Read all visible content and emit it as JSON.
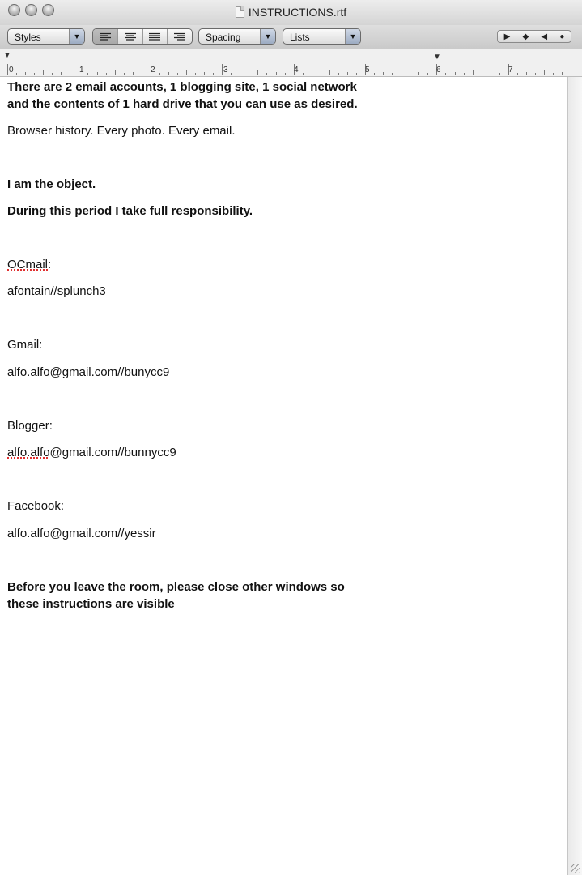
{
  "window": {
    "title": "INSTRUCTIONS.rtf"
  },
  "toolbar": {
    "styles_label": "Styles",
    "spacing_label": "Spacing",
    "lists_label": "Lists"
  },
  "ruler": {
    "numbers": [
      "0",
      "1",
      "2",
      "3",
      "4",
      "5",
      "6",
      "7"
    ]
  },
  "document": {
    "intro_line1": "There are 2 email accounts, 1 blogging site, 1 social network",
    "intro_line2": "and the contents of 1 hard drive that you can use as desired.",
    "browser_line": "Browser history. Every photo. Every email.",
    "object_line": "I am the object.",
    "responsibility_line": "During this period I take full responsibility.",
    "ocmail_label_a": "OCmail",
    "ocmail_label_b": ":",
    "ocmail_value": "afontain//splunch3",
    "gmail_label": "Gmail:",
    "gmail_value": "alfo.alfo@gmail.com//bunycc9",
    "blogger_label": "Blogger:",
    "blogger_value_a": "alfo.alfo",
    "blogger_value_b": "@gmail.com//bunnycc9",
    "facebook_label": "Facebook:",
    "facebook_value": "alfo.alfo@gmail.com//yessir",
    "closing_line1": "Before you leave the room, please close other windows so",
    "closing_line2": "these instructions are visible"
  }
}
